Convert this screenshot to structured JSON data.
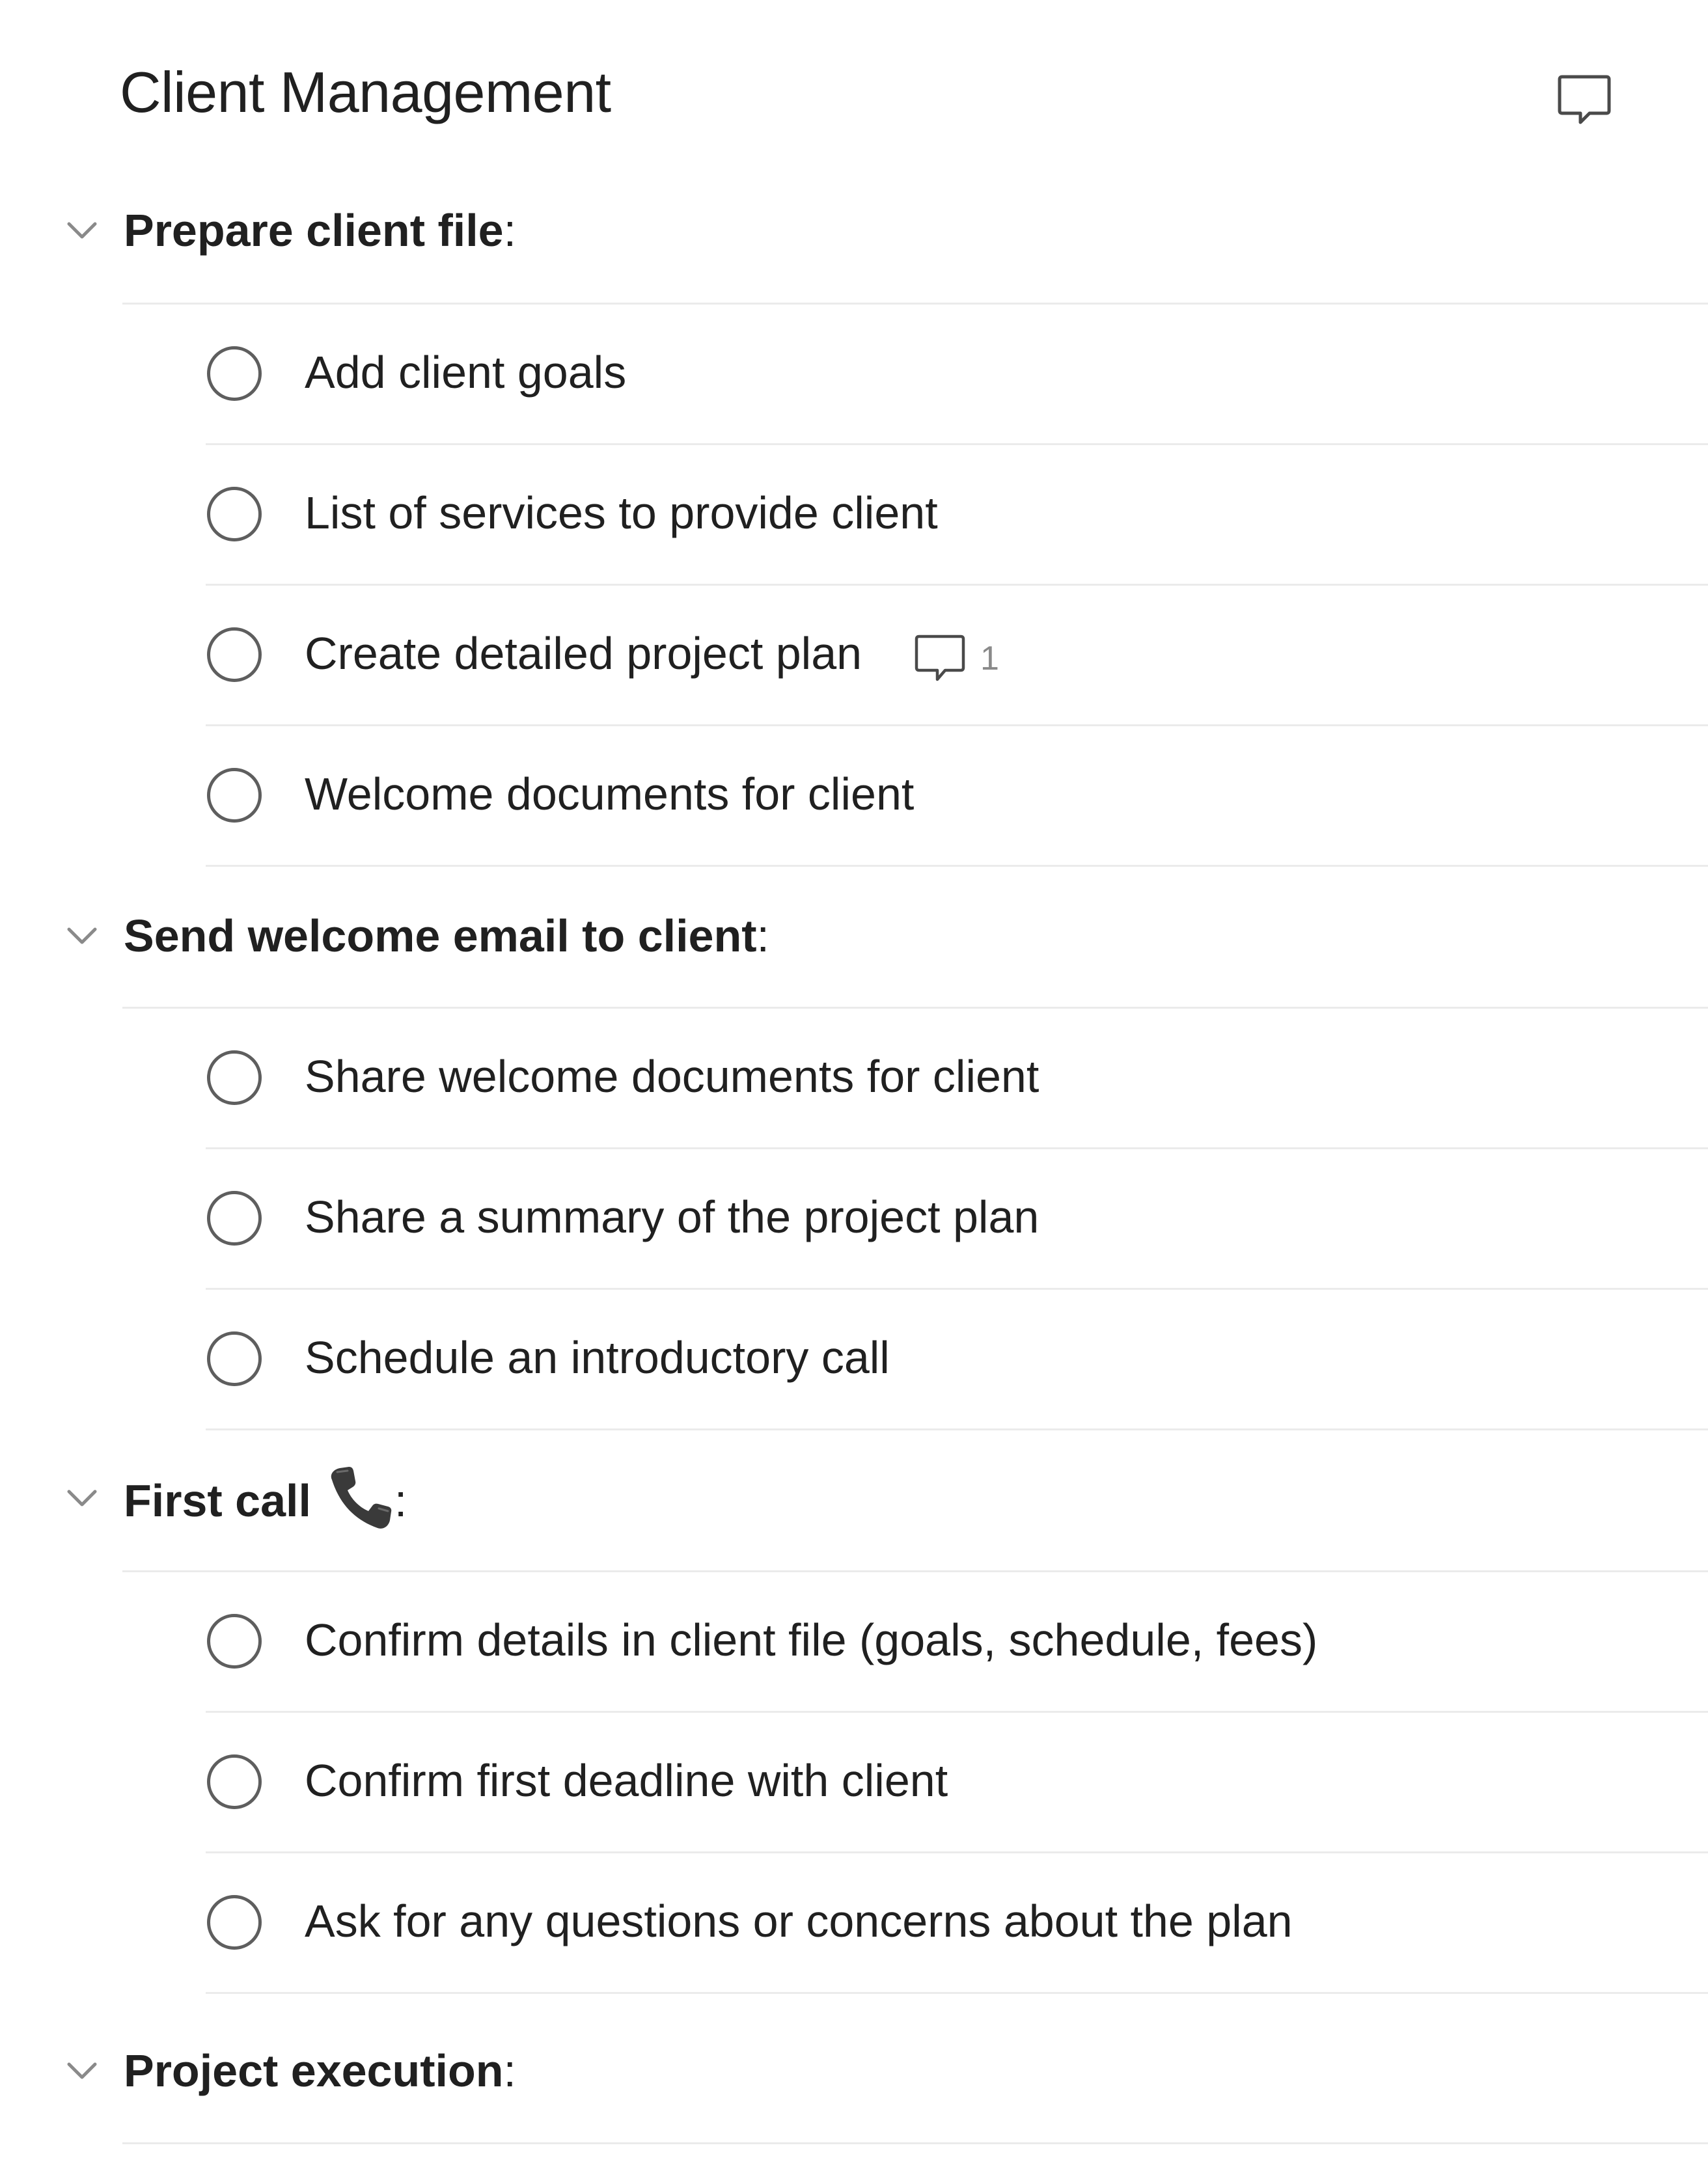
{
  "header": {
    "title": "Client Management",
    "comment_icon": "comment-bubble-icon"
  },
  "sections": [
    {
      "title": "Prepare client file",
      "suffix": ":",
      "expanded": true,
      "tasks": [
        {
          "label": "Add client goals",
          "completed": false
        },
        {
          "label": "List of services to provide client",
          "completed": false
        },
        {
          "label": "Create detailed project plan",
          "completed": false,
          "comment_count": "1"
        },
        {
          "label": "Welcome documents for client",
          "completed": false
        }
      ]
    },
    {
      "title": "Send welcome email to client",
      "suffix": ":",
      "expanded": true,
      "tasks": [
        {
          "label": "Share welcome documents for client",
          "completed": false
        },
        {
          "label": "Share a summary of the project plan",
          "completed": false
        },
        {
          "label": "Schedule an introductory call",
          "completed": false
        }
      ]
    },
    {
      "title": "First call",
      "suffix": ":",
      "emoji": "telephone-receiver-icon",
      "expanded": true,
      "tasks": [
        {
          "label": "Confirm details in client file (goals, schedule, fees)",
          "completed": false
        },
        {
          "label": "Confirm first deadline with client",
          "completed": false
        },
        {
          "label": "Ask for any questions or concerns about the plan",
          "completed": false
        }
      ]
    },
    {
      "title": "Project execution",
      "suffix": ":",
      "expanded": true,
      "tasks": []
    }
  ],
  "colors": {
    "text": "#202020",
    "muted": "#8a8a8a",
    "checkbox_border": "#5e5e5e",
    "divider": "#ebebeb",
    "chevron": "#8a8a8a",
    "phone_emoji": "#3a3a3a"
  }
}
